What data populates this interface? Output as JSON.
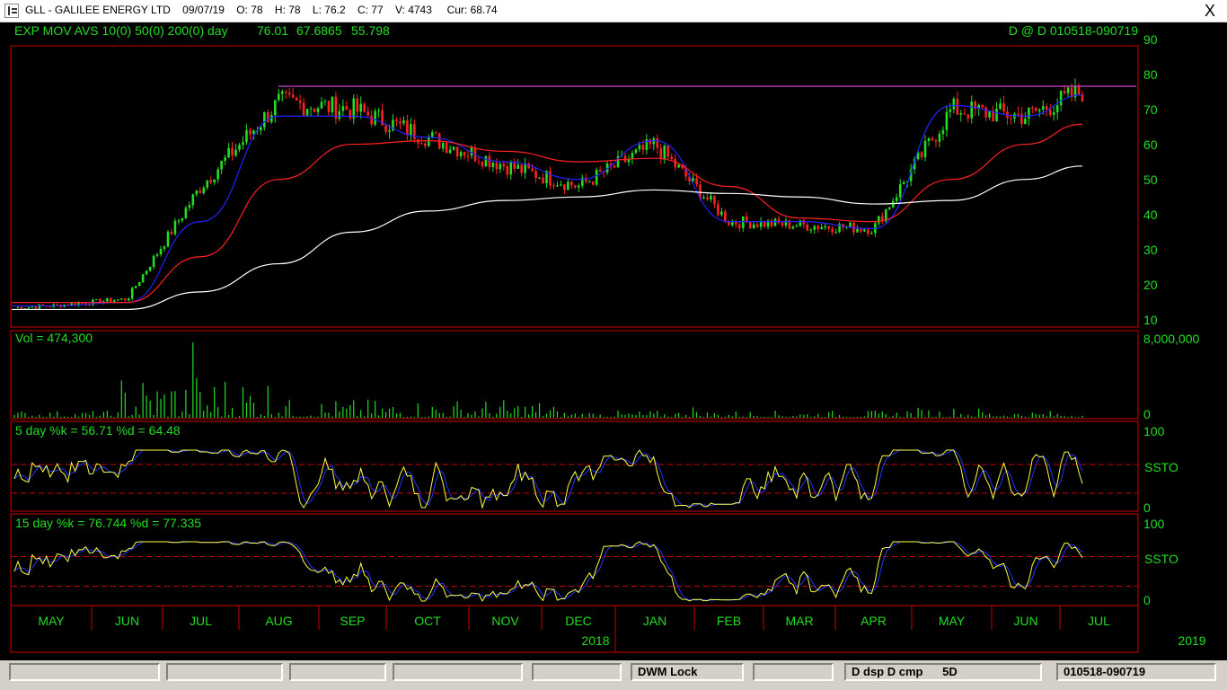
{
  "window": {
    "title": "GLL - GALILEE ENERGY LTD    09/07/19    O: 78    H: 78    L: 76.2    C: 77    V: 4743     Cur: 68.74",
    "close_label": "X"
  },
  "colors": {
    "background": "#000000",
    "frame": "#cc0000",
    "text": "#22dd22",
    "price_up": "#22dd22",
    "price_down": "#ff2020",
    "ema10": "#2222ff",
    "ema50": "#ff2020",
    "ema200": "#ffffff",
    "resistance": "#cc44cc",
    "stoch_k": "#ffff40",
    "stoch_d": "#2233ff",
    "volume": "#22dd22"
  },
  "header": {
    "indicator_label": "EXP MOV AVS 10(0) 50(0) 200(0)  day",
    "ema10_value": "76.01",
    "ema50_value": "67.6865",
    "ema200_value": "55.798",
    "range_label": "D @ D   010518-090719"
  },
  "panels": {
    "volume_label": "Vol = 474,300",
    "stoch5_label": "5 day   %k = 56.71    %d = 64.48",
    "stoch15_label": "15 day   %k = 76.744   %d = 77.335",
    "ssto_label": "SSTO",
    "price_ticks": [
      "90",
      "80",
      "70",
      "60",
      "50",
      "40",
      "30",
      "20",
      "10"
    ],
    "volume_ticks": [
      "8,000,000",
      "0"
    ],
    "stoch_ticks": [
      "100",
      "0"
    ]
  },
  "x_axis": {
    "months": [
      "MAY",
      "JUN",
      "JUL",
      "AUG",
      "SEP",
      "OCT",
      "NOV",
      "DEC",
      "JAN",
      "FEB",
      "MAR",
      "APR",
      "MAY",
      "JUN",
      "JUL"
    ],
    "years": [
      "2018",
      "2019"
    ]
  },
  "statusbar": {
    "fields": [
      "",
      "",
      "",
      "",
      "",
      "DWM Lock",
      "",
      "D dsp D cmp      5D",
      "010518-090719"
    ]
  },
  "chart_data": {
    "type": "candlestick",
    "title": "GLL - GALILEE ENERGY LTD",
    "range": "010518-090719",
    "last_bar": {
      "date": "09/07/19",
      "open": 78,
      "high": 78,
      "low": 76.2,
      "close": 77,
      "volume": 4743
    },
    "price_axis": {
      "ylim": [
        10,
        90
      ],
      "ticks": [
        10,
        20,
        30,
        40,
        50,
        60,
        70,
        80,
        90
      ]
    },
    "volume_axis": {
      "ylim": [
        0,
        8000000
      ],
      "current": 474300
    },
    "resistance_level": 78.5,
    "months": [
      "MAY",
      "JUN",
      "JUL",
      "AUG",
      "SEP",
      "OCT",
      "NOV",
      "DEC",
      "JAN",
      "FEB",
      "MAR",
      "APR",
      "MAY",
      "JUN",
      "JUL"
    ],
    "approx_monthly_close": [
      16,
      18,
      50,
      74,
      72,
      64,
      56,
      50,
      62,
      40,
      39,
      38,
      72,
      70,
      77
    ],
    "ema": [
      {
        "name": "EMA 10",
        "period": 10,
        "last": 76.01,
        "approx": [
          16,
          17,
          40,
          70,
          70,
          64,
          57,
          52,
          63,
          40,
          40,
          38,
          73,
          70,
          76
        ]
      },
      {
        "name": "EMA 50",
        "period": 50,
        "last": 67.6865,
        "approx": [
          17,
          17,
          30,
          52,
          62,
          63,
          60,
          57,
          58,
          50,
          41,
          40,
          52,
          62,
          67.7
        ]
      },
      {
        "name": "EMA 200",
        "period": 200,
        "last": 55.798,
        "approx": [
          15,
          15,
          20,
          28,
          37,
          43,
          46,
          47,
          49,
          48,
          47,
          45,
          46,
          52,
          55.8
        ]
      }
    ],
    "stochastic_5": {
      "k": 56.71,
      "d": 64.48,
      "overbought": 75,
      "oversold": 25
    },
    "stochastic_15": {
      "k": 76.744,
      "d": 77.335,
      "overbought": 75,
      "oversold": 25
    }
  }
}
